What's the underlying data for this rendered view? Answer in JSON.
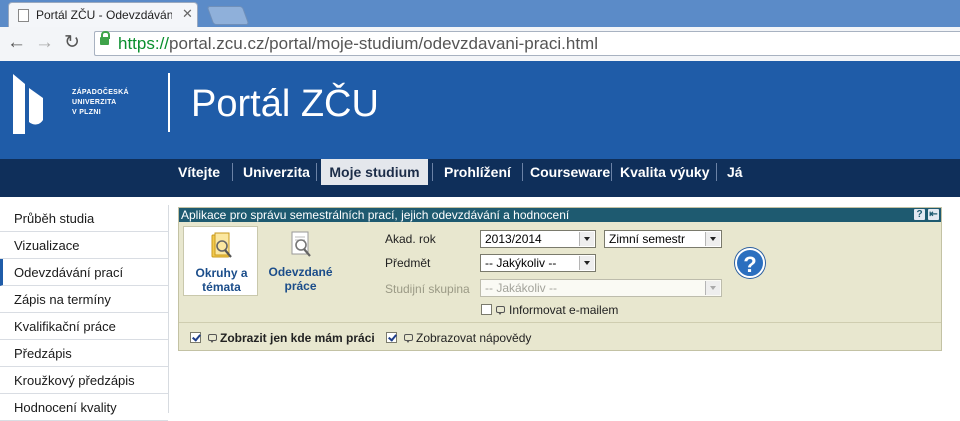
{
  "browser": {
    "tab_title": "Portál ZČU - Odevzdávání",
    "url_scheme": "https://",
    "url_rest": "portal.zcu.cz/portal/moje-studium/odevzdavani-praci.html"
  },
  "header": {
    "logo_lines": [
      "ZÁPADOČESKÁ",
      "UNIVERZITA",
      "V PLZNI"
    ],
    "title": "Portál ZČU"
  },
  "nav": {
    "items": [
      {
        "label": "Vítejte"
      },
      {
        "label": "Univerzita"
      },
      {
        "label": "Moje studium"
      },
      {
        "label": "Prohlížení"
      },
      {
        "label": "Courseware"
      },
      {
        "label": "Kvalita výuky"
      },
      {
        "label": "Já"
      }
    ],
    "active": "Moje studium"
  },
  "sidebar": {
    "items": [
      {
        "label": "Průběh studia"
      },
      {
        "label": "Vizualizace"
      },
      {
        "label": "Odevzdávání prací"
      },
      {
        "label": "Zápis na termíny"
      },
      {
        "label": "Kvalifikační práce"
      },
      {
        "label": "Předzápis"
      },
      {
        "label": "Kroužkový předzápis"
      },
      {
        "label": "Hodnocení kvality"
      }
    ],
    "active": "Odevzdávání prací"
  },
  "panel": {
    "title": "Aplikace pro správu semestrálních prací, jejich odevzdávání a hodnocení",
    "help_glyph": "?",
    "back_glyph": "⇤",
    "cards": [
      {
        "label": "Okruhy a témata"
      },
      {
        "label": "Odevzdané práce"
      }
    ],
    "form": {
      "akad_rok_label": "Akad. rok",
      "akad_rok_value": "2013/2014",
      "semestr_value": "Zimní semestr",
      "predmet_label": "Předmět",
      "predmet_value": "-- Jakýkoliv --",
      "skupina_label": "Studijní skupina",
      "skupina_value": "-- Jakákoliv --",
      "informovat_label": "Informovat e-mailem",
      "informovat_checked": false
    },
    "help_button_glyph": "?",
    "footer": {
      "zobrazit_label": "Zobrazit jen kde mám práci",
      "zobrazit_checked": true,
      "napovedy_label": "Zobrazovat nápovědy",
      "napovedy_checked": true
    }
  },
  "colors": {
    "header_blue": "#1f5ca8",
    "nav_dark": "#0f2f5a",
    "panel_head": "#1e5a70",
    "panel_bg": "#e8e7cf"
  }
}
